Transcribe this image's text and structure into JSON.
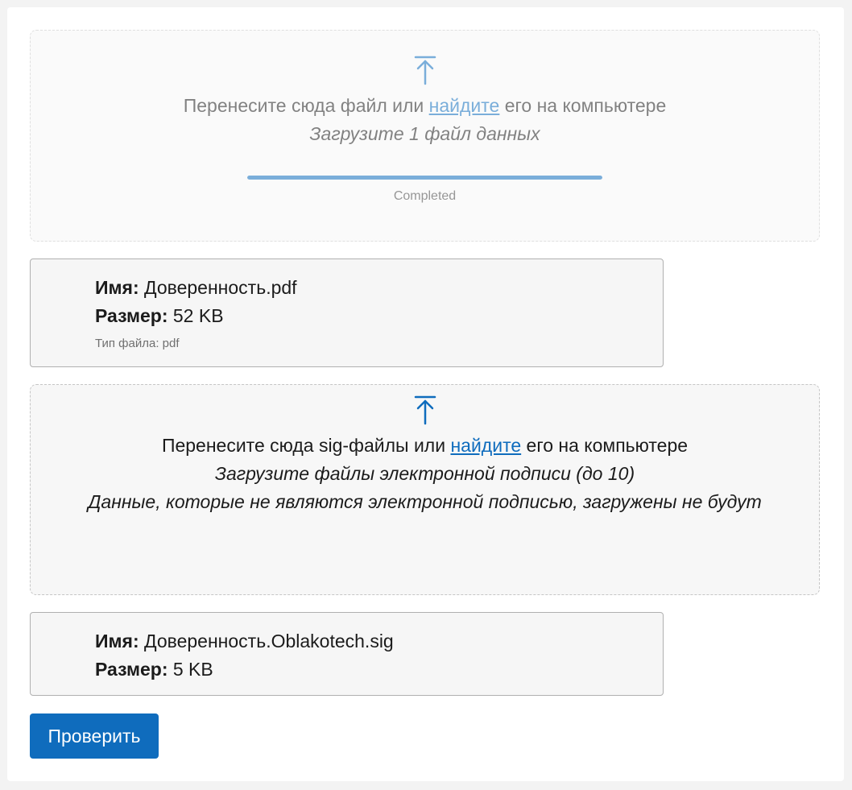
{
  "primary_dropzone": {
    "text_before_link": "Перенесите сюда файл или ",
    "link": "найдите",
    "text_after_link": " его на компьютере",
    "hint": "Загрузите 1 файл данных",
    "progress": 1.0,
    "progress_label": "Completed",
    "icon": "upload-arrow-icon",
    "disabled": true
  },
  "primary_file": {
    "name_label": "Имя:",
    "name_value": "Доверенность.pdf",
    "size_label": "Размер:",
    "size_value": "52 KB",
    "type_text": "Тип файла: pdf"
  },
  "signature_dropzone": {
    "text_before_link": "Перенесите сюда sig-файлы или ",
    "link": "найдите",
    "text_after_link": " его на компьютере",
    "hint": "Загрузите файлы электронной подписи (до 10)",
    "note": "Данные, которые не являются электронной подписью, загружены не будут",
    "icon": "upload-arrow-icon"
  },
  "signature_file": {
    "name_label": "Имя:",
    "name_value": "Доверенность.Oblakotech.sig",
    "size_label": "Размер:",
    "size_value": "5 KB"
  },
  "submit": {
    "label": "Проверить"
  },
  "colors": {
    "accent": "#0f6cbd",
    "page_background": "#f3f3f3",
    "card_background": "#ffffff",
    "dropzone_background": "#f7f7f7"
  }
}
